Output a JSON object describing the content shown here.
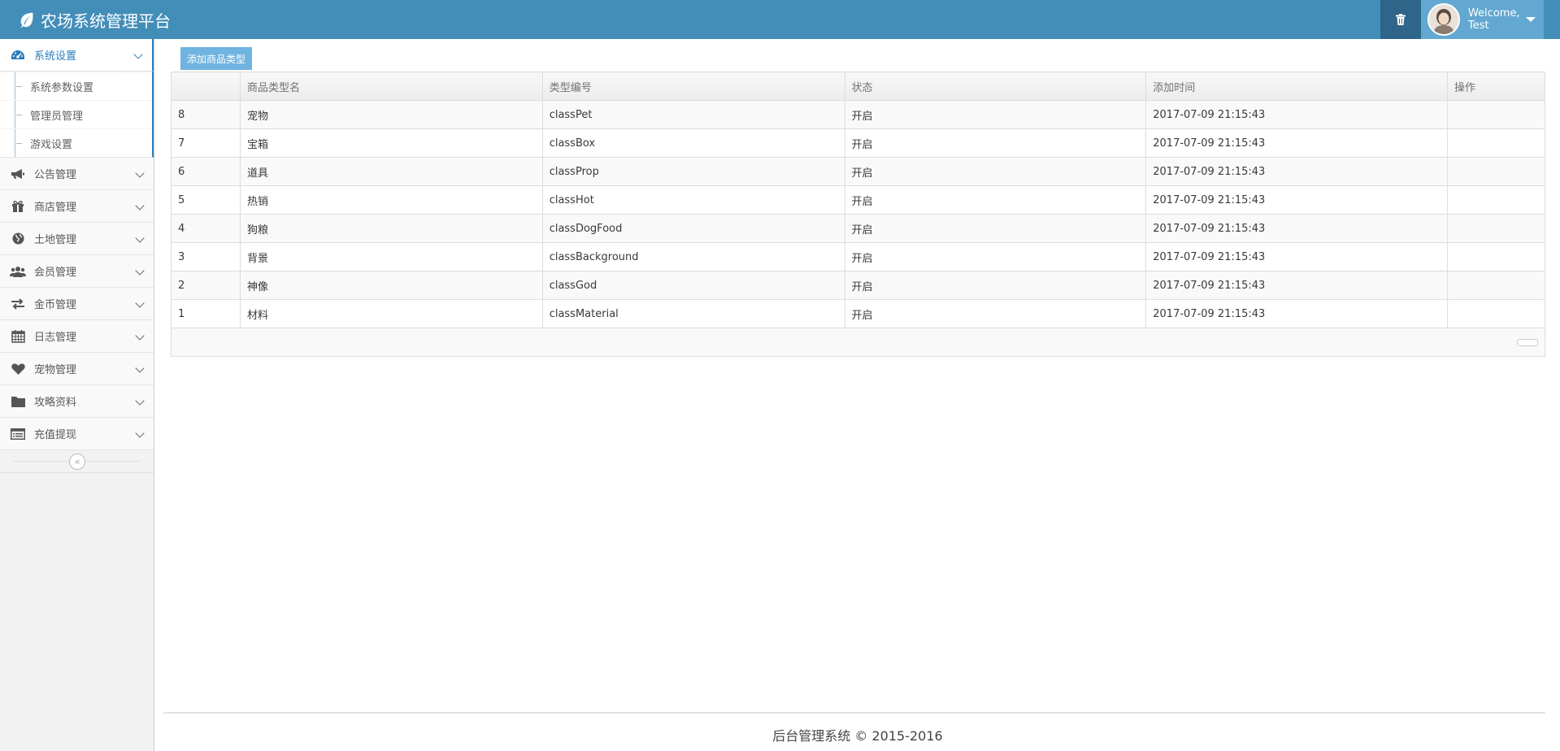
{
  "header": {
    "title": "农场系统管理平台",
    "welcome": "Welcome,",
    "username": "Test"
  },
  "sidebar": {
    "active": {
      "label": "系统设置",
      "icon": "dashboard-icon"
    },
    "subitems": [
      "系统参数设置",
      "管理员管理",
      "游戏设置"
    ],
    "items": [
      {
        "label": "公告管理",
        "icon": "bullhorn-icon"
      },
      {
        "label": "商店管理",
        "icon": "gift-icon"
      },
      {
        "label": "土地管理",
        "icon": "globe-icon"
      },
      {
        "label": "会员管理",
        "icon": "users-icon"
      },
      {
        "label": "金币管理",
        "icon": "exchange-icon"
      },
      {
        "label": "日志管理",
        "icon": "calendar-icon"
      },
      {
        "label": "宠物管理",
        "icon": "heart-icon"
      },
      {
        "label": "攻略资料",
        "icon": "folder-icon"
      },
      {
        "label": "充值提现",
        "icon": "list-alt-icon"
      }
    ]
  },
  "main": {
    "add_button": "添加商品类型",
    "columns": [
      "",
      "商品类型名",
      "类型编号",
      "状态",
      "添加时间",
      "操作"
    ],
    "rows": [
      [
        "8",
        "宠物",
        "classPet",
        "开启",
        "2017-07-09 21:15:43",
        ""
      ],
      [
        "7",
        "宝箱",
        "classBox",
        "开启",
        "2017-07-09 21:15:43",
        ""
      ],
      [
        "6",
        "道具",
        "classProp",
        "开启",
        "2017-07-09 21:15:43",
        ""
      ],
      [
        "5",
        "热销",
        "classHot",
        "开启",
        "2017-07-09 21:15:43",
        ""
      ],
      [
        "4",
        "狗粮",
        "classDogFood",
        "开启",
        "2017-07-09 21:15:43",
        ""
      ],
      [
        "3",
        "背景",
        "classBackground",
        "开启",
        "2017-07-09 21:15:43",
        ""
      ],
      [
        "2",
        "神像",
        "classGod",
        "开启",
        "2017-07-09 21:15:43",
        ""
      ],
      [
        "1",
        "材料",
        "classMaterial",
        "开启",
        "2017-07-09 21:15:43",
        ""
      ]
    ]
  },
  "footer": {
    "text": "后台管理系统 © 2015-2016"
  },
  "colors": {
    "header": "#438eb9",
    "accent": "#2b7dbc",
    "button": "#6fb3e0"
  }
}
